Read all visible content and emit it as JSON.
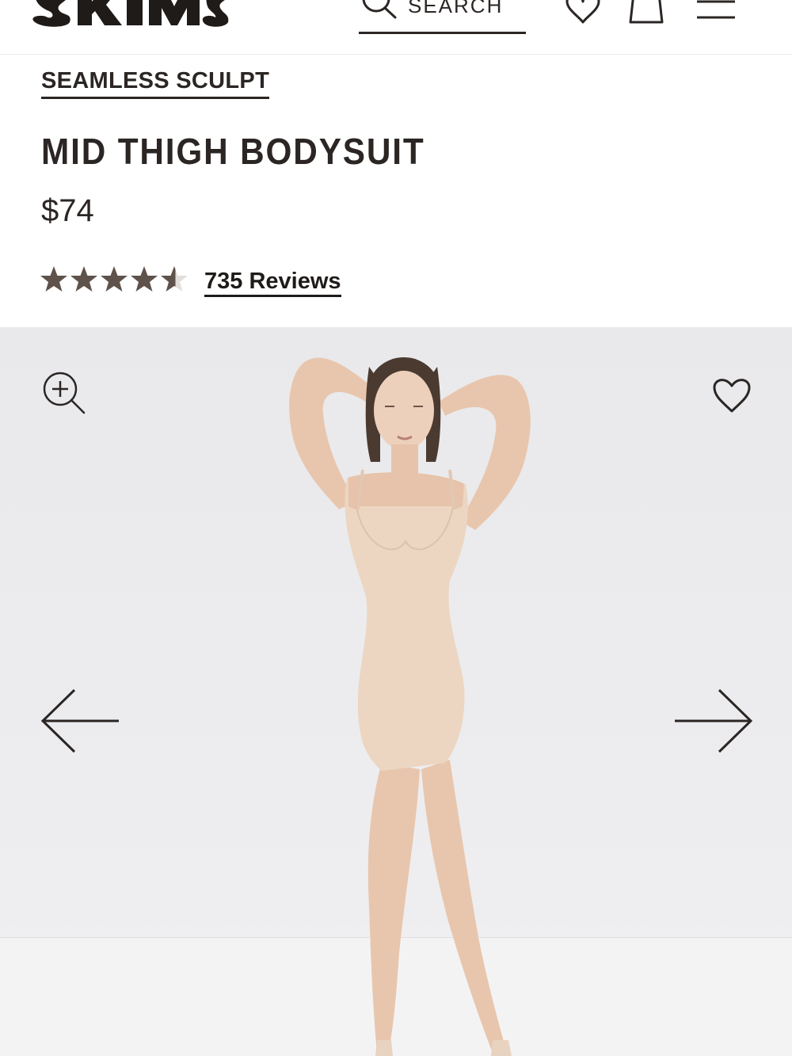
{
  "header": {
    "brand": "SKIMS",
    "search_label": "SEARCH",
    "icons": [
      "search-icon",
      "heart-icon",
      "bag-icon",
      "menu-icon"
    ]
  },
  "product": {
    "collection": "SEAMLESS SCULPT",
    "name": "MID THIGH BODYSUIT",
    "price": "$74",
    "rating": 4.5,
    "rating_max": 5,
    "reviews_label": "735 Reviews"
  },
  "gallery": {
    "icons": [
      "zoom-in-icon",
      "heart-icon",
      "arrow-left-icon",
      "arrow-right-icon"
    ]
  },
  "colors": {
    "text": "#2b2624",
    "star": "#5e524a",
    "gallery_bg": "#ececee",
    "bodysuit": "#ecd6c2"
  }
}
